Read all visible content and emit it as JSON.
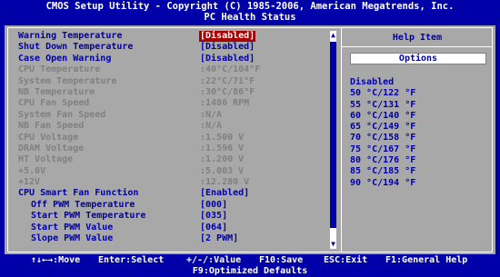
{
  "header": {
    "line1": "CMOS Setup Utility - Copyright (C) 1985-2006, American Megatrends, Inc.",
    "line2": "PC Health Status"
  },
  "settings": [
    {
      "label": "Warning Temperature",
      "value": "[Disabled]"
    },
    {
      "label": "Shut Down Temperature",
      "value": "[Disabled]"
    },
    {
      "label": "Case Open Warning",
      "value": "[Disabled]"
    },
    {
      "label": "CPU Temperature",
      "value": ":40°C/104°F"
    },
    {
      "label": "System Temperature",
      "value": ":22°C/71°F"
    },
    {
      "label": "NB Temperature",
      "value": ":30°C/86°F"
    },
    {
      "label": "CPU Fan Speed",
      "value": ":1486 RPM"
    },
    {
      "label": "System Fan Speed",
      "value": ":N/A"
    },
    {
      "label": "NB Fan Speed",
      "value": ":N/A"
    },
    {
      "label": "CPU Voltage",
      "value": ":1.500 V"
    },
    {
      "label": "DRAM Voltage",
      "value": ":1.596 V"
    },
    {
      "label": "HT Voltage",
      "value": ":1.200 V"
    },
    {
      "label": "+5.0V",
      "value": ":5.003 V"
    },
    {
      "label": "+12V",
      "value": ":12.280 V"
    },
    {
      "label": "CPU Smart Fan Function",
      "value": "[Enabled]"
    },
    {
      "label": "Off PWM Temperature",
      "value": "[000]"
    },
    {
      "label": "Start PWM Temperature",
      "value": "[035]"
    },
    {
      "label": "Start PWM Value",
      "value": "[064]"
    },
    {
      "label": "Slope PWM Value",
      "value": "[2 PWM]"
    }
  ],
  "help": {
    "title": "Help Item",
    "options_label": "Options",
    "options": [
      "Disabled",
      "50 °C/122 °F",
      "55 °C/131 °F",
      "60 °C/140 °F",
      "65 °C/149 °F",
      "70 °C/158 °F",
      "75 °C/167 °F",
      "80 °C/176 °F",
      "85 °C/185 °F",
      "90 °C/194 °F"
    ]
  },
  "footer": {
    "move": "↑↓←→:Move",
    "select": "Enter:Select",
    "value": "+/-/:Value",
    "save": "F10:Save",
    "exit": "ESC:Exit",
    "help": "F1:General Help",
    "optimized": "F9:Optimized Defaults"
  },
  "colors": {
    "background": "#0000a8",
    "panel": "#a8a8a8",
    "highlight": "#a80000",
    "inactive_text": "#808080"
  }
}
